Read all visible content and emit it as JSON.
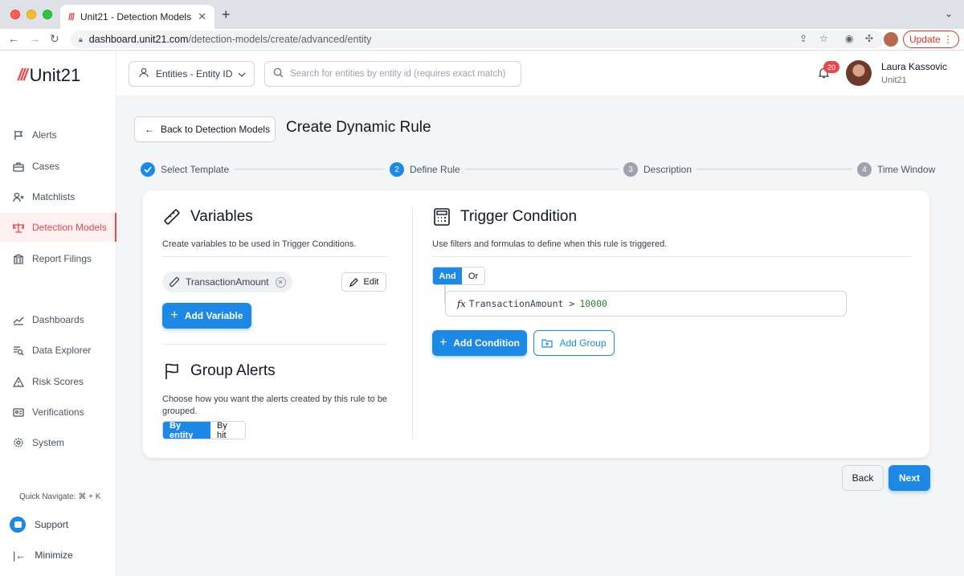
{
  "browser": {
    "tab_title": "Unit21 - Detection Models",
    "url_host": "dashboard.unit21.com",
    "url_path": "/detection-models/create/advanced/entity",
    "update_label": "Update"
  },
  "brand": {
    "name": "Unit21",
    "accent": "#e5484d",
    "primary": "#1e88e5"
  },
  "sidebar": {
    "items": [
      {
        "label": "Alerts",
        "icon": "flag-icon"
      },
      {
        "label": "Cases",
        "icon": "briefcase-icon"
      },
      {
        "label": "Matchlists",
        "icon": "user-x-icon"
      },
      {
        "label": "Detection Models",
        "icon": "scale-icon",
        "active": true
      },
      {
        "label": "Report Filings",
        "icon": "bank-icon"
      },
      {
        "label": "Dashboards",
        "icon": "chart-line-icon"
      },
      {
        "label": "Data Explorer",
        "icon": "search-list-icon"
      },
      {
        "label": "Risk Scores",
        "icon": "warning-icon"
      },
      {
        "label": "Verifications",
        "icon": "id-card-icon"
      },
      {
        "label": "System",
        "icon": "gear-icon"
      }
    ],
    "quick_navigate": "Quick Navigate: ⌘ + K",
    "support": "Support",
    "minimize": "Minimize"
  },
  "header": {
    "entity_select": "Entities - Entity ID",
    "search_placeholder": "Search for entities by entity id (requires exact match)",
    "notification_count": "20",
    "user_name": "Laura Kassovic",
    "user_org": "Unit21"
  },
  "page": {
    "back_label": "Back to Detection Models",
    "title": "Create Dynamic Rule",
    "steps": [
      {
        "num": "1",
        "label": "Select Template",
        "state": "done"
      },
      {
        "num": "2",
        "label": "Define Rule",
        "state": "current"
      },
      {
        "num": "3",
        "label": "Description",
        "state": "pending"
      },
      {
        "num": "4",
        "label": "Time Window",
        "state": "pending"
      }
    ],
    "variables": {
      "title": "Variables",
      "description": "Create variables to be used in Trigger Conditions.",
      "chip": "TransactionAmount",
      "edit_label": "Edit",
      "add_label": "Add Variable"
    },
    "group_alerts": {
      "title": "Group Alerts",
      "description": "Choose how you want the alerts created by this rule to be grouped.",
      "options": [
        "By entity",
        "By hit"
      ],
      "selected": "By entity"
    },
    "trigger": {
      "title": "Trigger Condition",
      "description": "Use filters and formulas to define when this rule is triggered.",
      "logic_options": [
        "And",
        "Or"
      ],
      "logic_selected": "And",
      "condition_fx": "fx",
      "condition_field": "TransactionAmount",
      "condition_op": ">",
      "condition_value": "10000",
      "add_condition": "Add Condition",
      "add_group": "Add Group"
    },
    "back_button": "Back",
    "next_button": "Next"
  }
}
